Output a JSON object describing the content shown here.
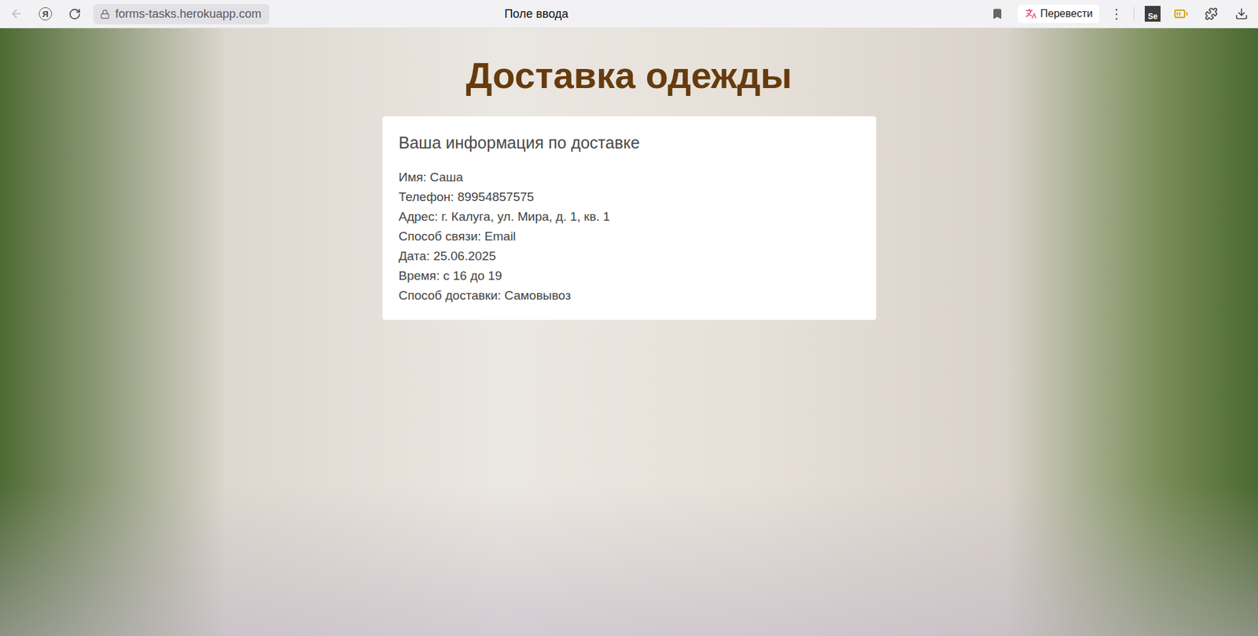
{
  "browser": {
    "yandex_glyph": "Я",
    "url": "forms-tasks.herokuapp.com",
    "tab_title": "Поле ввода",
    "translate_button": "Перевести",
    "menu_glyph": "⋮",
    "extension_label": "Se"
  },
  "page": {
    "heading": "Доставка одежды",
    "card": {
      "title": "Ваша информация по доставке",
      "lines": [
        "Имя: Саша",
        "Телефон: 89954857575",
        "Адрес: г. Калуга, ул. Мира, д. 1, кв. 1",
        "Способ связи: Email",
        "Дата: 25.06.2025",
        "Время: с 16 до 19",
        "Способ доставки: Самовывоз"
      ]
    }
  }
}
